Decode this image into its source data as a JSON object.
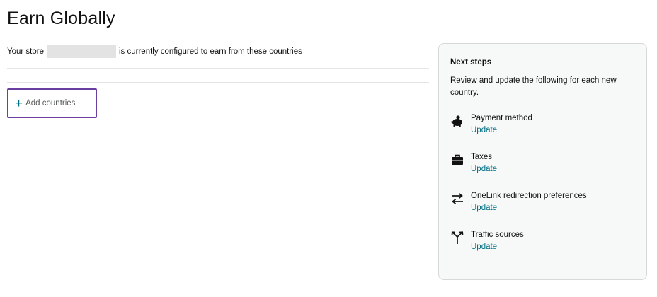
{
  "header": {
    "title": "Earn Globally"
  },
  "store": {
    "prefix": "Your store",
    "suffix": "is currently configured to earn from these countries"
  },
  "add_countries": {
    "plus": "+",
    "label": "Add countries"
  },
  "next_steps": {
    "title": "Next steps",
    "description": "Review and update the following for each new country.",
    "items": [
      {
        "icon": "piggy-bank-icon",
        "label": "Payment method",
        "link": "Update"
      },
      {
        "icon": "briefcase-icon",
        "label": "Taxes",
        "link": "Update"
      },
      {
        "icon": "swap-arrows-icon",
        "label": "OneLink redirection preferences",
        "link": "Update"
      },
      {
        "icon": "split-arrows-icon",
        "label": "Traffic sources",
        "link": "Update"
      }
    ]
  },
  "colors": {
    "link": "#007185",
    "focus_outline": "#6b3fa0",
    "panel_bg": "#f7f8f8"
  }
}
